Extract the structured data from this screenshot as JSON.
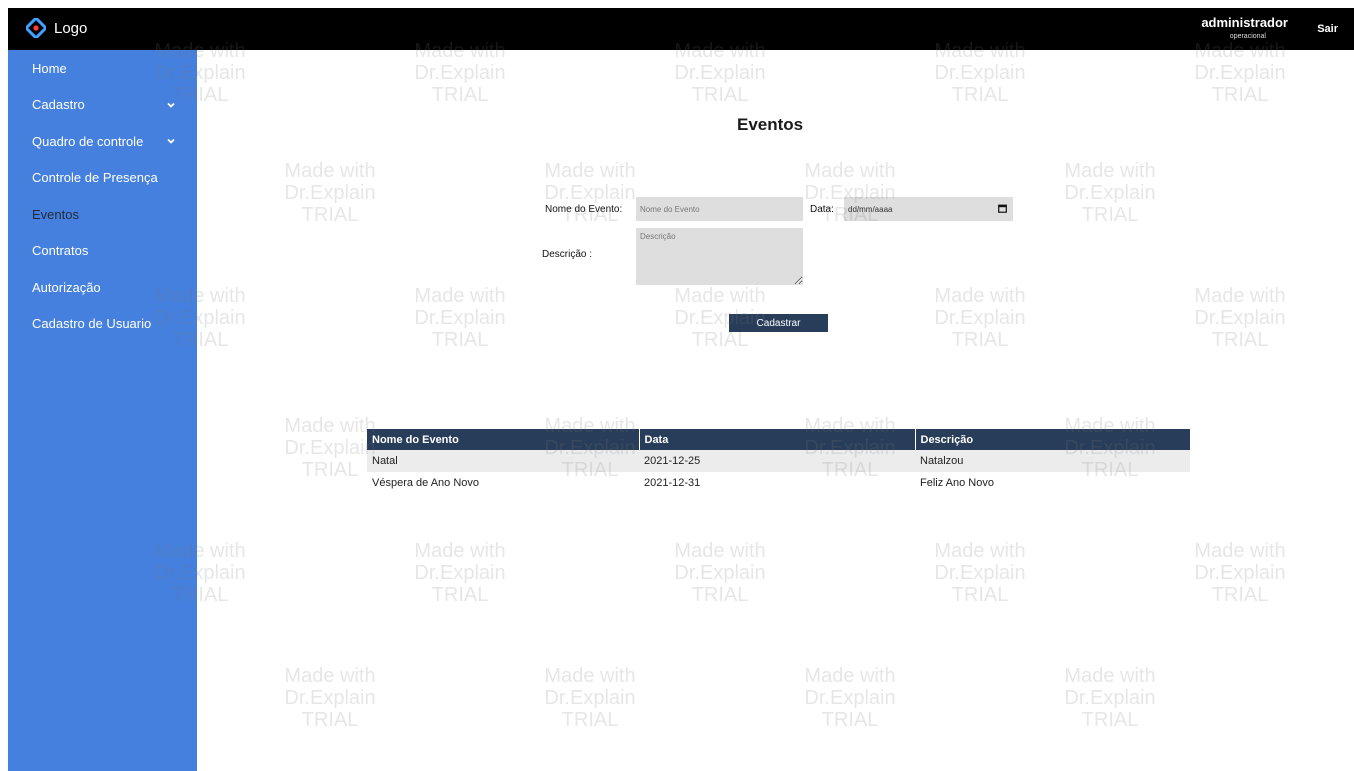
{
  "header": {
    "logo_text": "Logo",
    "user_name": "administrador",
    "user_role": "operacional",
    "logout_label": "Sair"
  },
  "sidebar": {
    "items": [
      {
        "label": "Home",
        "has_chevron": false,
        "active": false
      },
      {
        "label": "Cadastro",
        "has_chevron": true,
        "active": false
      },
      {
        "label": "Quadro de controle",
        "has_chevron": true,
        "active": false
      },
      {
        "label": "Controle de Presença",
        "has_chevron": false,
        "active": false
      },
      {
        "label": "Eventos",
        "has_chevron": false,
        "active": true
      },
      {
        "label": "Contratos",
        "has_chevron": false,
        "active": false
      },
      {
        "label": "Autorização",
        "has_chevron": false,
        "active": false
      },
      {
        "label": "Cadastro de Usuario",
        "has_chevron": false,
        "active": false
      }
    ]
  },
  "main": {
    "title": "Eventos",
    "form": {
      "name_label": "Nome do Evento:",
      "name_placeholder": "Nome do Evento",
      "name_value": "",
      "date_label": "Data:",
      "date_placeholder": "dd/mm/aaaa",
      "description_label": "Descrição :",
      "description_placeholder": "Descrição",
      "description_value": "",
      "submit_label": "Cadastrar"
    },
    "table": {
      "headers": [
        "Nome do Evento",
        "Data",
        "Descrição"
      ],
      "rows": [
        [
          "Natal",
          "2021-12-25",
          "Natalzou"
        ],
        [
          "Véspera de Ano Novo",
          "2021-12-31",
          "Feliz Ano Novo"
        ]
      ]
    }
  },
  "watermark": {
    "line1": "Made with",
    "line2": "Dr.Explain",
    "line3": "TRIAL"
  },
  "colors": {
    "topbar": "#000000",
    "sidebar": "#4580de",
    "accent": "#283d59",
    "field_bg": "#dedede"
  },
  "icons": [
    "logo-diamond-icon",
    "chevron-down-icon",
    "calendar-icon"
  ]
}
